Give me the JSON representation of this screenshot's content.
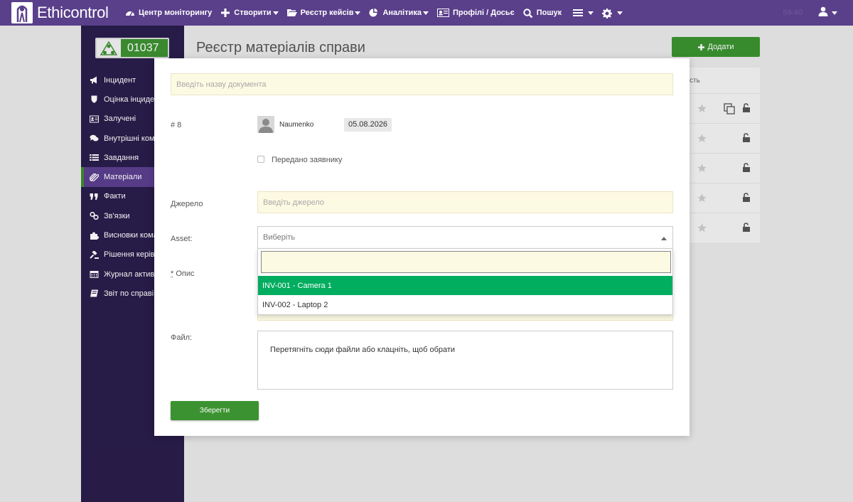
{
  "app": {
    "brand": "Ethicontrol",
    "clock": "59:40"
  },
  "nav": {
    "items": [
      {
        "label": "Центр моніторингу",
        "icon": "dashboard-icon",
        "caret": false
      },
      {
        "label": "Створити",
        "icon": "plus-icon",
        "caret": true
      },
      {
        "label": "Реєстр кейсів",
        "icon": "folder-open-icon",
        "caret": true
      },
      {
        "label": "Аналітика",
        "icon": "pie-chart-icon",
        "caret": true
      },
      {
        "label": "Профілі / Досьє",
        "icon": "id-card-icon",
        "caret": false
      },
      {
        "label": "Пошук",
        "icon": "search-icon",
        "caret": false
      }
    ]
  },
  "sidebar": {
    "case_number": "01037",
    "items": [
      {
        "label": "Інцидент",
        "icon": "bullhorn-icon"
      },
      {
        "label": "Оцінка інцидент",
        "icon": "shield-icon"
      },
      {
        "label": "Залучені",
        "icon": "id-card-icon"
      },
      {
        "label": "Внутрішні коме",
        "icon": "comments-icon"
      },
      {
        "label": "Завдання",
        "icon": "list-icon"
      },
      {
        "label": "Матеріали",
        "icon": "paperclip-icon",
        "active": true
      },
      {
        "label": "Факти",
        "icon": "quote-icon"
      },
      {
        "label": "Зв'язки",
        "icon": "link-icon"
      },
      {
        "label": "Висновки кома",
        "icon": "puzzle-icon"
      },
      {
        "label": "Рішення керівн",
        "icon": "gavel-icon"
      },
      {
        "label": "Журнал активн",
        "icon": "calendar-icon"
      },
      {
        "label": "Звіт по справі",
        "icon": "book-icon"
      }
    ]
  },
  "page": {
    "title": "Реєстр матеріалів справи",
    "add_button": "Додати",
    "panel_header_fragment": "сть"
  },
  "modal": {
    "doc_name_placeholder": "Введіть назву документа",
    "record_number": "# 8",
    "author": "Naumenko",
    "date": "05.08.2026",
    "transferred_label": "Передано заявнику",
    "transferred_checked": false,
    "source_label": "Джерело",
    "source_placeholder": "Введіть джерело",
    "asset_label": "Asset:",
    "asset_placeholder": "Виберіть",
    "asset_options": [
      "INV-001 - Camera 1",
      "INV-002 - Laptop 2"
    ],
    "asset_highlighted_index": 0,
    "description_required_mark": "*",
    "description_label": "Опис",
    "file_label": "Файл:",
    "file_drop_text": "Перетягніть сюди файли або клацніть, щоб обрати",
    "save_button": "Зберегти"
  },
  "colors": {
    "navbar": "#5a3f8a",
    "sidebar": "#2a1d4b",
    "sidebar_active": "#5b3f8f",
    "primary_green": "#3a9330",
    "option_highlight": "#01ad5f",
    "input_yellow": "#fdfae3"
  }
}
